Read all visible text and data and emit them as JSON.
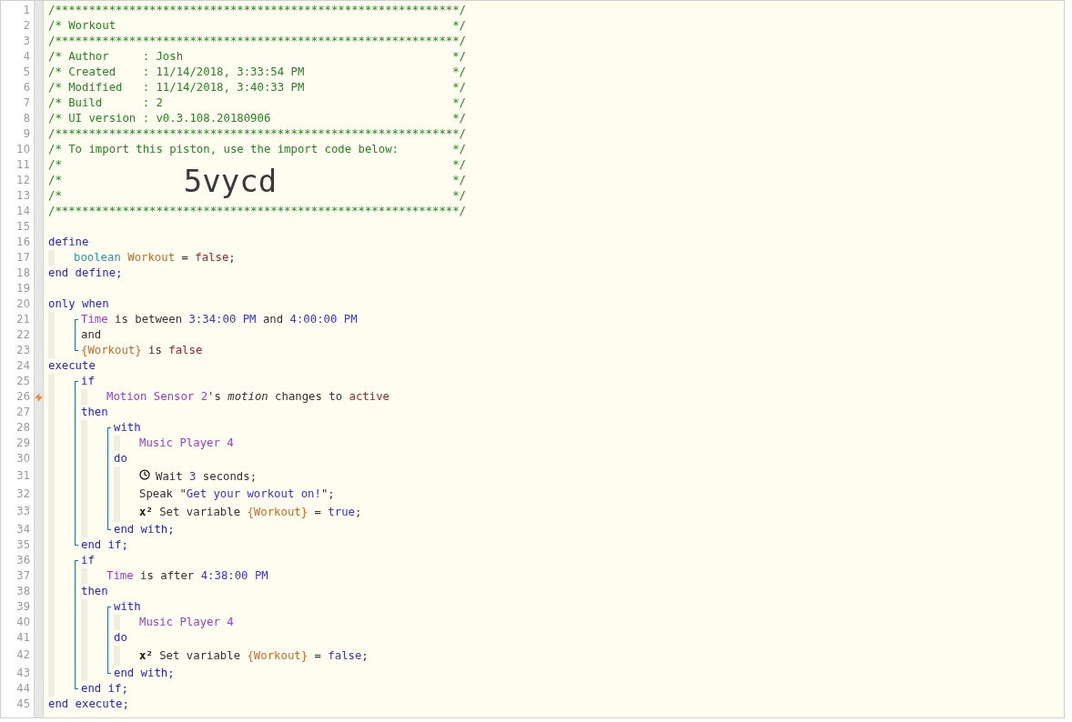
{
  "editor": {
    "lines": [
      {
        "kind": "line",
        "number": "1",
        "tokens": [
          {
            "text": "/************************************************************/",
            "kind": "comment"
          }
        ]
      },
      {
        "kind": "line",
        "number": "2",
        "tokens": [
          {
            "text": "/* Workout",
            "kind": "comment"
          },
          {
            "text": "*/",
            "kind": "comment_end"
          }
        ]
      },
      {
        "kind": "line",
        "number": "3",
        "tokens": [
          {
            "text": "/************************************************************/",
            "kind": "comment"
          }
        ]
      },
      {
        "kind": "line",
        "number": "4",
        "tokens": [
          {
            "text": "/* Author     : Josh",
            "kind": "comment"
          },
          {
            "text": "*/",
            "kind": "comment_end"
          }
        ]
      },
      {
        "kind": "line",
        "number": "5",
        "tokens": [
          {
            "text": "/* Created    : 11/14/2018, 3:33:54 PM",
            "kind": "comment"
          },
          {
            "text": "*/",
            "kind": "comment_end"
          }
        ]
      },
      {
        "kind": "line",
        "number": "6",
        "tokens": [
          {
            "text": "/* Modified   : 11/14/2018, 3:40:33 PM",
            "kind": "comment"
          },
          {
            "text": "*/",
            "kind": "comment_end"
          }
        ]
      },
      {
        "kind": "line",
        "number": "7",
        "tokens": [
          {
            "text": "/* Build      : 2",
            "kind": "comment"
          },
          {
            "text": "*/",
            "kind": "comment_end"
          }
        ]
      },
      {
        "kind": "line",
        "number": "8",
        "tokens": [
          {
            "text": "/* UI version : v0.3.108.20180906",
            "kind": "comment"
          },
          {
            "text": "*/",
            "kind": "comment_end"
          }
        ]
      },
      {
        "kind": "line",
        "number": "9",
        "tokens": [
          {
            "text": "/************************************************************/",
            "kind": "comment"
          }
        ]
      },
      {
        "kind": "line",
        "number": "10",
        "tokens": [
          {
            "text": "/* To import this piston, use the import code below:",
            "kind": "comment"
          },
          {
            "text": "*/",
            "kind": "comment_end"
          }
        ]
      },
      {
        "kind": "line",
        "number": "11",
        "tokens": [
          {
            "text": "/*",
            "kind": "comment"
          },
          {
            "text": "*/",
            "kind": "comment_end"
          }
        ]
      },
      {
        "kind": "line",
        "number": "12",
        "tokens": [
          {
            "text": "/*",
            "kind": "comment"
          },
          {
            "text": "5vycd",
            "kind": "import_code"
          },
          {
            "text": "*/",
            "kind": "comment_end"
          }
        ]
      },
      {
        "kind": "line",
        "number": "13",
        "tokens": [
          {
            "text": "/*",
            "kind": "comment"
          },
          {
            "text": "*/",
            "kind": "comment_end"
          }
        ]
      },
      {
        "kind": "line",
        "number": "14",
        "tokens": [
          {
            "text": "/************************************************************/",
            "kind": "comment"
          }
        ]
      },
      {
        "kind": "line",
        "number": "15"
      },
      {
        "kind": "line",
        "number": "16",
        "tokens": [
          {
            "text": "define",
            "kind": "keyword"
          }
        ],
        "children": [
          {
            "kind": "line",
            "number": "17",
            "tokens": [
              {
                "text": "boolean ",
                "kind": "type"
              },
              {
                "text": "Workout",
                "kind": "variable"
              },
              {
                "text": " = ",
                "kind": "plain"
              },
              {
                "text": "false",
                "kind": "literal"
              },
              {
                "text": ";",
                "kind": "plain"
              }
            ]
          }
        ]
      },
      {
        "kind": "line",
        "number": "18",
        "tokens": [
          {
            "text": "end define;",
            "kind": "keyword"
          }
        ]
      },
      {
        "kind": "line",
        "number": "19"
      },
      {
        "kind": "line",
        "number": "20",
        "tokens": [
          {
            "text": "only when",
            "kind": "keyword"
          }
        ],
        "children": [
          {
            "kind": "group",
            "children": [
              {
                "kind": "line",
                "number": "21",
                "tokens": [
                  {
                    "text": "Time",
                    "kind": "device"
                  },
                  {
                    "text": " is between ",
                    "kind": "plain"
                  },
                  {
                    "text": "3:34:00 PM",
                    "kind": "value"
                  },
                  {
                    "text": " and ",
                    "kind": "plain"
                  },
                  {
                    "text": "4:00:00 PM",
                    "kind": "value"
                  }
                ]
              },
              {
                "kind": "line",
                "number": "22",
                "tokens": [
                  {
                    "text": "and",
                    "kind": "plain"
                  }
                ]
              },
              {
                "kind": "line",
                "number": "23",
                "tokens": [
                  {
                    "text": "{Workout}",
                    "kind": "variable"
                  },
                  {
                    "text": " is ",
                    "kind": "plain"
                  },
                  {
                    "text": "false",
                    "kind": "literal"
                  }
                ]
              }
            ]
          }
        ]
      },
      {
        "kind": "line",
        "number": "24",
        "tokens": [
          {
            "text": "execute",
            "kind": "keyword"
          }
        ],
        "children": [
          {
            "kind": "group",
            "children": [
              {
                "kind": "line",
                "number": "25",
                "tokens": [
                  {
                    "text": "if",
                    "kind": "keyword"
                  }
                ],
                "children": [
                  {
                    "kind": "trigger",
                    "number": "26",
                    "tokens": [
                      {
                        "text": "Motion Sensor 2",
                        "kind": "device"
                      },
                      {
                        "text": "'s ",
                        "kind": "plain"
                      },
                      {
                        "text": "motion",
                        "kind": "attribute"
                      },
                      {
                        "text": " changes to ",
                        "kind": "plain"
                      },
                      {
                        "text": "active",
                        "kind": "literal"
                      }
                    ]
                  }
                ]
              },
              {
                "kind": "line",
                "number": "27",
                "tokens": [
                  {
                    "text": "then",
                    "kind": "keyword"
                  }
                ],
                "children": [
                  {
                    "kind": "group",
                    "children": [
                      {
                        "kind": "line",
                        "number": "28",
                        "tokens": [
                          {
                            "text": "with",
                            "kind": "keyword"
                          }
                        ],
                        "children": [
                          {
                            "kind": "line",
                            "number": "29",
                            "tokens": [
                              {
                                "text": "Music Player 4",
                                "kind": "device"
                              }
                            ]
                          }
                        ]
                      },
                      {
                        "kind": "line",
                        "number": "30",
                        "tokens": [
                          {
                            "text": "do",
                            "kind": "keyword"
                          }
                        ],
                        "children": [
                          {
                            "kind": "wait",
                            "number": "31",
                            "tokens": [
                              {
                                "text": "Wait ",
                                "kind": "plain"
                              },
                              {
                                "text": "3",
                                "kind": "value"
                              },
                              {
                                "text": " seconds;",
                                "kind": "plain"
                              }
                            ]
                          },
                          {
                            "kind": "line",
                            "number": "32",
                            "tokens": [
                              {
                                "text": "Speak \"",
                                "kind": "plain"
                              },
                              {
                                "text": "Get your workout on!",
                                "kind": "value"
                              },
                              {
                                "text": "\";",
                                "kind": "plain"
                              }
                            ]
                          },
                          {
                            "kind": "line",
                            "number": "33",
                            "tokens": [
                              {
                                "text": "x²",
                                "kind": "badge"
                              },
                              {
                                "text": " Set variable ",
                                "kind": "plain"
                              },
                              {
                                "text": "{Workout}",
                                "kind": "variable"
                              },
                              {
                                "text": " = ",
                                "kind": "plain"
                              },
                              {
                                "text": "true",
                                "kind": "value"
                              },
                              {
                                "text": ";",
                                "kind": "plain"
                              }
                            ]
                          }
                        ]
                      },
                      {
                        "kind": "line",
                        "number": "34",
                        "tokens": [
                          {
                            "text": "end with;",
                            "kind": "keyword"
                          }
                        ]
                      }
                    ]
                  }
                ]
              },
              {
                "kind": "line",
                "number": "35",
                "tokens": [
                  {
                    "text": "end if;",
                    "kind": "keyword"
                  }
                ]
              }
            ]
          },
          {
            "kind": "group",
            "children": [
              {
                "kind": "line",
                "number": "36",
                "tokens": [
                  {
                    "text": "if",
                    "kind": "keyword"
                  }
                ],
                "children": [
                  {
                    "kind": "line",
                    "number": "37",
                    "tokens": [
                      {
                        "text": "Time",
                        "kind": "device"
                      },
                      {
                        "text": " is after ",
                        "kind": "plain"
                      },
                      {
                        "text": "4:38:00 PM",
                        "kind": "value"
                      }
                    ]
                  }
                ]
              },
              {
                "kind": "line",
                "number": "38",
                "tokens": [
                  {
                    "text": "then",
                    "kind": "keyword"
                  }
                ],
                "children": [
                  {
                    "kind": "group",
                    "children": [
                      {
                        "kind": "line",
                        "number": "39",
                        "tokens": [
                          {
                            "text": "with",
                            "kind": "keyword"
                          }
                        ],
                        "children": [
                          {
                            "kind": "line",
                            "number": "40",
                            "tokens": [
                              {
                                "text": "Music Player 4",
                                "kind": "device"
                              }
                            ]
                          }
                        ]
                      },
                      {
                        "kind": "line",
                        "number": "41",
                        "tokens": [
                          {
                            "text": "do",
                            "kind": "keyword"
                          }
                        ],
                        "children": [
                          {
                            "kind": "line",
                            "number": "42",
                            "tokens": [
                              {
                                "text": "x²",
                                "kind": "badge"
                              },
                              {
                                "text": " Set variable ",
                                "kind": "plain"
                              },
                              {
                                "text": "{Workout}",
                                "kind": "variable"
                              },
                              {
                                "text": " = ",
                                "kind": "plain"
                              },
                              {
                                "text": "false",
                                "kind": "value"
                              },
                              {
                                "text": ";",
                                "kind": "plain"
                              }
                            ]
                          }
                        ]
                      },
                      {
                        "kind": "line",
                        "number": "43",
                        "tokens": [
                          {
                            "text": "end with;",
                            "kind": "keyword"
                          }
                        ]
                      }
                    ]
                  }
                ]
              },
              {
                "kind": "line",
                "number": "44",
                "tokens": [
                  {
                    "text": "end if;",
                    "kind": "keyword"
                  }
                ]
              }
            ]
          }
        ]
      },
      {
        "kind": "line",
        "number": "45",
        "tokens": [
          {
            "text": "end execute;",
            "kind": "keyword"
          }
        ]
      }
    ]
  }
}
